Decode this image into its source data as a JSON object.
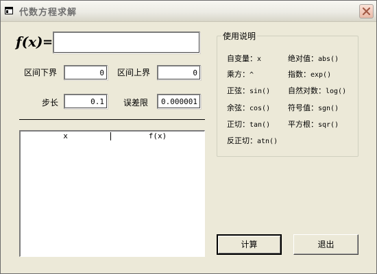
{
  "window": {
    "title": "代数方程求解",
    "close_icon": "close-icon"
  },
  "formula": {
    "label": "f(x)",
    "equals": "=",
    "value": ""
  },
  "fields": {
    "lower_label": "区间下界",
    "lower_value": "0",
    "upper_label": "区间上界",
    "upper_value": "0",
    "step_label": "步长",
    "step_value": "0.1",
    "tolerance_label": "误差限",
    "tolerance_value": "0.000001"
  },
  "results": {
    "columns": [
      "x",
      "f(x)"
    ],
    "rows": []
  },
  "help": {
    "title": "使用说明",
    "items": [
      {
        "label": "自变量：",
        "code": "x"
      },
      {
        "label": "绝对值：",
        "code": "abs()"
      },
      {
        "label": "乘方：",
        "code": "^"
      },
      {
        "label": "指数：",
        "code": "exp()"
      },
      {
        "label": "正弦：",
        "code": "sin()"
      },
      {
        "label": "自然对数：",
        "code": "log()"
      },
      {
        "label": "余弦：",
        "code": "cos()"
      },
      {
        "label": "符号值：",
        "code": "sgn()"
      },
      {
        "label": "正切：",
        "code": "tan()"
      },
      {
        "label": "平方根：",
        "code": "sqr()"
      },
      {
        "label": "反正切：",
        "code": "atn()"
      }
    ]
  },
  "buttons": {
    "compute_label": "计算",
    "exit_label": "退出"
  },
  "colors": {
    "window_bg": "#ece9d8",
    "title_text": "#6f6f6f",
    "close_button": "#e9b8a6"
  }
}
